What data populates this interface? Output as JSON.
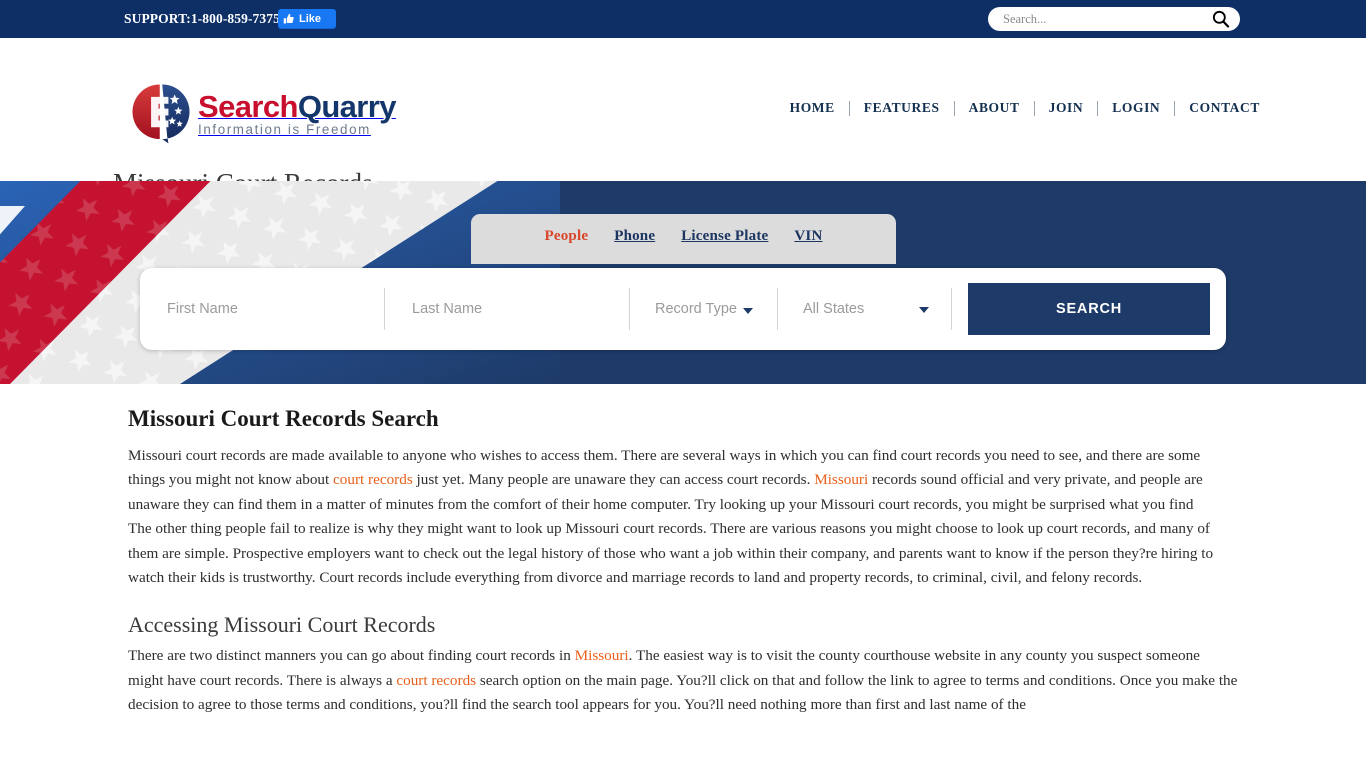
{
  "topbar": {
    "support": "SUPPORT:1-800-859-7375",
    "fb_like_label": "Like",
    "fb_thumb_icon": "thumbs-up-icon",
    "search_placeholder": "Search...",
    "search_value": "",
    "search_icon": "search-icon"
  },
  "header": {
    "logo_word_1": "Search",
    "logo_word_2": "Quarry",
    "logo_tagline": "Information is Freedom",
    "logo_icon": "searchquarry-logo-icon",
    "nav": [
      {
        "label": "HOME"
      },
      {
        "label": "FEATURES"
      },
      {
        "label": "ABOUT"
      },
      {
        "label": "JOIN"
      },
      {
        "label": "LOGIN"
      },
      {
        "label": "CONTACT"
      }
    ],
    "page_title": "Missouri Court Records"
  },
  "hero": {
    "tabs": [
      {
        "label": "People",
        "active": true
      },
      {
        "label": "Phone",
        "active": false
      },
      {
        "label": "License Plate",
        "active": false
      },
      {
        "label": "VIN",
        "active": false
      }
    ],
    "form": {
      "first_name_placeholder": "First Name",
      "first_name_value": "",
      "last_name_placeholder": "Last Name",
      "last_name_value": "",
      "record_type_label": "Record Type",
      "state_label": "All States",
      "search_button": "SEARCH",
      "caret_icon": "chevron-down-icon"
    },
    "accent_navy": "#1e3a68",
    "flag_red": "#c41230"
  },
  "content": {
    "section_title": "Missouri Court Records Search",
    "paragraph_1_a": "Missouri court records are made available to anyone who wishes to access them. There are several ways in which you can find court records you need to see, and there are some things you might not know about ",
    "paragraph_1_link1": "court records",
    "paragraph_1_b": " just yet. Many people are unaware they can access court records. ",
    "paragraph_1_link2": "Missouri",
    "paragraph_1_c": " records sound official and very private, and people are unaware they can find them in a matter of minutes from the comfort of their home computer. Try looking up your Missouri court records, you might be surprised what you find",
    "paragraph_2": "The other thing people fail to realize is why they might want to look up Missouri court records. There are various reasons you might choose to look up court records, and many of them are simple. Prospective employers want to check out the legal history of those who want a job within their company, and parents want to know if the person they?re hiring to watch their kids is trustworthy. Court records include everything from divorce and marriage records to land and property records, to criminal, civil, and felony records.",
    "sub_title": "Accessing Missouri Court Records",
    "paragraph_3_a": "There are two distinct manners you can go about finding court records in ",
    "paragraph_3_link1": "Missouri",
    "paragraph_3_b": ". The easiest way is to visit the county courthouse website in any county you suspect someone might have court records. There is always a ",
    "paragraph_3_link2": "court records",
    "paragraph_3_c": " search option on the main page. You?ll click on that and follow the link to agree to terms and conditions. Once you make the decision to agree to those terms and conditions, you?ll find the search tool appears for you. You?ll need nothing more than first and last name of the",
    "link_color": "#e8601c"
  }
}
